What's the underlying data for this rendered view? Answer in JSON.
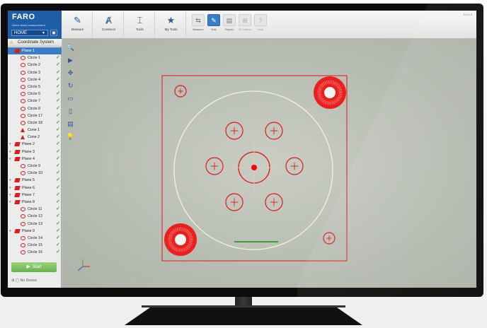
{
  "app": {
    "logo": "FARO",
    "file_name": "Demo block measurement",
    "version": "5.0.0.9"
  },
  "toolbar": {
    "home_label": "HOME",
    "main_buttons": [
      {
        "label": "Measure",
        "icon": "probe-icon"
      },
      {
        "label": "Construct",
        "icon": "compass-icon"
      },
      {
        "label": "Tools",
        "icon": "tools-icon"
      },
      {
        "label": "My Tools",
        "icon": "star-icon"
      }
    ],
    "small_buttons": [
      {
        "label": "Measure",
        "icon": "ruler-icon",
        "active": false
      },
      {
        "label": "Edit",
        "icon": "pencil-icon",
        "active": true
      },
      {
        "label": "Report",
        "icon": "printer-icon",
        "active": false
      },
      {
        "label": "3D Callout",
        "icon": "callout-icon",
        "active": false
      },
      {
        "label": "Help",
        "icon": "help-icon",
        "active": false
      }
    ]
  },
  "tree": {
    "header": "Coordinate System",
    "items": [
      {
        "type": "plane",
        "name": "Plane 1",
        "level": 0,
        "checked": true,
        "selected": true
      },
      {
        "type": "circle",
        "name": "Circle 1",
        "level": 1,
        "checked": true
      },
      {
        "type": "circle",
        "name": "Circle 2",
        "level": 1,
        "checked": true
      },
      {
        "type": "circle",
        "name": "Circle 3",
        "level": 1,
        "checked": true
      },
      {
        "type": "circle",
        "name": "Circle 4",
        "level": 1,
        "checked": true
      },
      {
        "type": "circle",
        "name": "Circle 5",
        "level": 1,
        "checked": true
      },
      {
        "type": "circle",
        "name": "Circle 6",
        "level": 1,
        "checked": true
      },
      {
        "type": "circle",
        "name": "Circle 7",
        "level": 1,
        "checked": true
      },
      {
        "type": "circle",
        "name": "Circle 8",
        "level": 1,
        "checked": true
      },
      {
        "type": "circle",
        "name": "Circle 17",
        "level": 1,
        "checked": true
      },
      {
        "type": "circle",
        "name": "Circle 18",
        "level": 1,
        "checked": true
      },
      {
        "type": "cone",
        "name": "Cone 1",
        "level": 1,
        "checked": true
      },
      {
        "type": "cone",
        "name": "Cone 2",
        "level": 1,
        "checked": true
      },
      {
        "type": "plane",
        "name": "Plane 2",
        "level": 0,
        "checked": true
      },
      {
        "type": "plane",
        "name": "Plane 3",
        "level": 0,
        "checked": true
      },
      {
        "type": "plane",
        "name": "Plane 4",
        "level": 0,
        "checked": true
      },
      {
        "type": "circle",
        "name": "Circle 9",
        "level": 1,
        "checked": true
      },
      {
        "type": "circle",
        "name": "Circle 10",
        "level": 1,
        "checked": true
      },
      {
        "type": "plane",
        "name": "Plane 5",
        "level": 0,
        "checked": true
      },
      {
        "type": "plane",
        "name": "Plane 6",
        "level": 0,
        "checked": true
      },
      {
        "type": "plane",
        "name": "Plane 7",
        "level": 0,
        "checked": true
      },
      {
        "type": "plane",
        "name": "Plane 8",
        "level": 0,
        "checked": true
      },
      {
        "type": "circle",
        "name": "Circle 11",
        "level": 1,
        "checked": true
      },
      {
        "type": "circle",
        "name": "Circle 12",
        "level": 1,
        "checked": true
      },
      {
        "type": "circle",
        "name": "Circle 13",
        "level": 1,
        "checked": true
      },
      {
        "type": "plane",
        "name": "Plane 9",
        "level": 0,
        "checked": true
      },
      {
        "type": "circle",
        "name": "Circle 14",
        "level": 1,
        "checked": true
      },
      {
        "type": "circle",
        "name": "Circle 15",
        "level": 1,
        "checked": true
      },
      {
        "type": "circle",
        "name": "Circle 16",
        "level": 1,
        "checked": true
      }
    ],
    "start_label": "Start",
    "device_status": "No Device"
  },
  "viewport_tools": [
    {
      "icon": "zoom-icon",
      "glyph": "🔍"
    },
    {
      "icon": "camera-icon",
      "glyph": "▶"
    },
    {
      "icon": "pan-icon",
      "glyph": "✥"
    },
    {
      "icon": "rotate-icon",
      "glyph": "↻"
    },
    {
      "icon": "view-front-icon",
      "glyph": "▭"
    },
    {
      "icon": "view-side-icon",
      "glyph": "▯"
    },
    {
      "icon": "view-top-icon",
      "glyph": "▤"
    },
    {
      "icon": "light-icon",
      "glyph": "💡"
    }
  ],
  "colors": {
    "feature_red": "#e01818",
    "bore_circle": "#f4f2d6",
    "brand_blue": "#1f5ea6",
    "check_green": "#3aa63a"
  }
}
